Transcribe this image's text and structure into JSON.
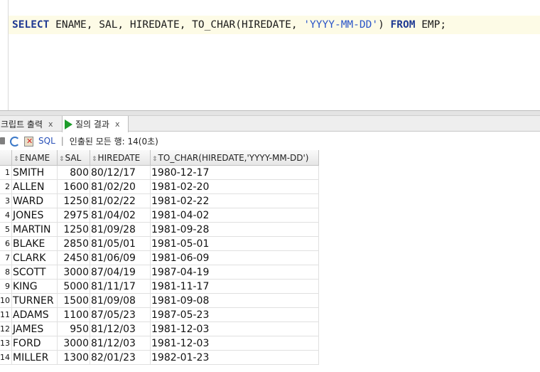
{
  "editor": {
    "sql_parts": {
      "kw_select": "SELECT",
      "columns": " ENAME, SAL, HIREDATE, TO_CHAR(HIREDATE, ",
      "format_string": "'YYYY-MM-DD'",
      "close_paren": ") ",
      "kw_from": "FROM",
      "table": " EMP;"
    }
  },
  "tabs": {
    "script_output_label": "크립트 출력",
    "query_result_label": "질의 결과",
    "close_glyph": "x"
  },
  "toolbar": {
    "sql_label": "SQL",
    "separator": "|",
    "status": "인출된 모든 행: 14(0초)"
  },
  "icons": {
    "run": "run-statement-icon",
    "pin": "pin-icon",
    "refresh": "refresh-icon",
    "cancel": "cancel-sql-icon",
    "sort": "sort-icon"
  },
  "colors": {
    "keyword": "#1f3a93",
    "string": "#2a55c8",
    "run_green": "#1d9c2a"
  },
  "grid": {
    "sort_glyph": "⇕",
    "columns": [
      "ENAME",
      "SAL",
      "HIREDATE",
      "TO_CHAR(HIREDATE,'YYYY-MM-DD')"
    ],
    "rows": [
      {
        "num": "1",
        "ename": "SMITH",
        "sal": "800",
        "hiredate": "80/12/17",
        "to_char": "1980-12-17"
      },
      {
        "num": "2",
        "ename": "ALLEN",
        "sal": "1600",
        "hiredate": "81/02/20",
        "to_char": "1981-02-20"
      },
      {
        "num": "3",
        "ename": "WARD",
        "sal": "1250",
        "hiredate": "81/02/22",
        "to_char": "1981-02-22"
      },
      {
        "num": "4",
        "ename": "JONES",
        "sal": "2975",
        "hiredate": "81/04/02",
        "to_char": "1981-04-02"
      },
      {
        "num": "5",
        "ename": "MARTIN",
        "sal": "1250",
        "hiredate": "81/09/28",
        "to_char": "1981-09-28"
      },
      {
        "num": "6",
        "ename": "BLAKE",
        "sal": "2850",
        "hiredate": "81/05/01",
        "to_char": "1981-05-01"
      },
      {
        "num": "7",
        "ename": "CLARK",
        "sal": "2450",
        "hiredate": "81/06/09",
        "to_char": "1981-06-09"
      },
      {
        "num": "8",
        "ename": "SCOTT",
        "sal": "3000",
        "hiredate": "87/04/19",
        "to_char": "1987-04-19"
      },
      {
        "num": "9",
        "ename": "KING",
        "sal": "5000",
        "hiredate": "81/11/17",
        "to_char": "1981-11-17"
      },
      {
        "num": "10",
        "ename": "TURNER",
        "sal": "1500",
        "hiredate": "81/09/08",
        "to_char": "1981-09-08"
      },
      {
        "num": "11",
        "ename": "ADAMS",
        "sal": "1100",
        "hiredate": "87/05/23",
        "to_char": "1987-05-23"
      },
      {
        "num": "12",
        "ename": "JAMES",
        "sal": "950",
        "hiredate": "81/12/03",
        "to_char": "1981-12-03"
      },
      {
        "num": "13",
        "ename": "FORD",
        "sal": "3000",
        "hiredate": "81/12/03",
        "to_char": "1981-12-03"
      },
      {
        "num": "14",
        "ename": "MILLER",
        "sal": "1300",
        "hiredate": "82/01/23",
        "to_char": "1982-01-23"
      }
    ]
  }
}
